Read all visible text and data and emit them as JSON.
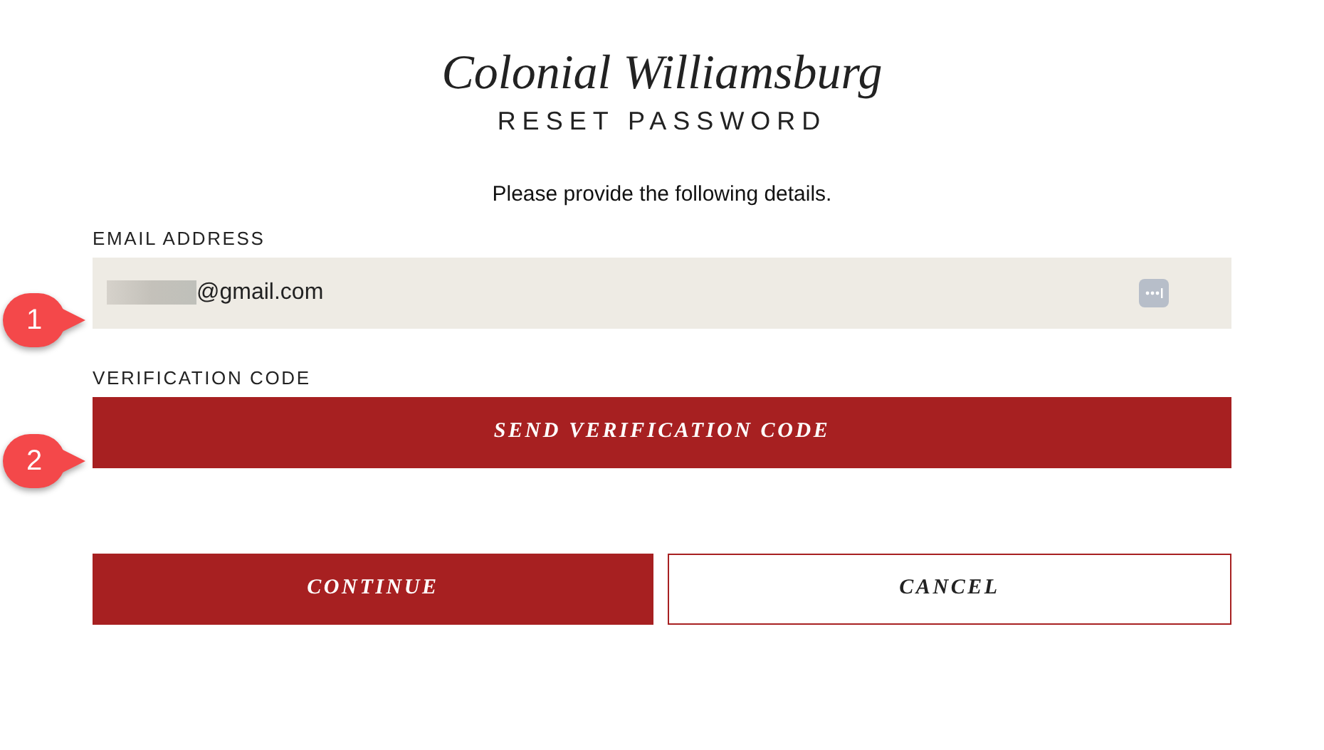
{
  "logo": "Colonial Williamsburg",
  "title": "RESET PASSWORD",
  "intro": "Please provide the following details.",
  "email": {
    "label": "EMAIL ADDRESS",
    "value": "@gmail.com",
    "callout": "1"
  },
  "verification": {
    "label": "VERIFICATION CODE",
    "button": "SEND VERIFICATION CODE",
    "callout": "2"
  },
  "buttons": [
    {
      "label": "CONTINUE",
      "kind": "primary"
    },
    {
      "label": "CANCEL",
      "kind": "secondary"
    }
  ]
}
